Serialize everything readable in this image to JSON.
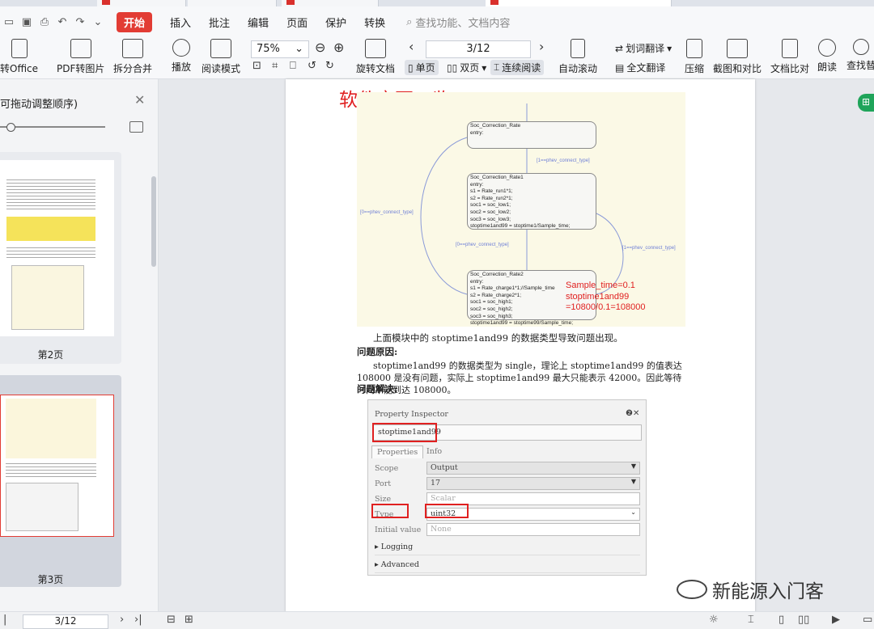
{
  "menubar": {
    "start": "开始",
    "items": [
      "插入",
      "批注",
      "编辑",
      "页面",
      "保护",
      "转换"
    ],
    "search": "查找功能、文档内容"
  },
  "toolbar": {
    "to_office": "转Office",
    "pdf_to_image": "PDF转图片",
    "split_merge": "拆分合并",
    "play": "播放",
    "read_mode": "阅读模式",
    "zoom": "75%",
    "rotate": "旋转文档",
    "page": "3/12",
    "single": "单页",
    "double": "双页",
    "continuous": "连续阅读",
    "auto_scroll": "自动滚动",
    "word_translate": "划词翻译",
    "full_translate": "全文翻译",
    "compress": "压缩",
    "screenshot_compare": "截图和对比",
    "doc_compare": "文档比对",
    "read_aloud": "朗读",
    "find_replace": "查找替"
  },
  "left_panel": {
    "title": "可拖动调整顺序)",
    "thumbs": [
      {
        "label": "第2页"
      },
      {
        "label": "第3页"
      }
    ]
  },
  "document": {
    "title": "软件变更一览",
    "diagram": {
      "states": [
        {
          "name": "Soc_Correction_Rate",
          "lines": [
            "entry:"
          ]
        },
        {
          "name": "Soc_Correction_Rate1",
          "lines": [
            "entry:",
            "s1 = Rate_run1*1;",
            "s2 = Rate_run2*1;",
            "soc1 = soc_low1;",
            "soc2 = soc_low2;",
            "soc3 = soc_low3;",
            "stoptime1and99 = stoptime1/Sample_time;"
          ]
        },
        {
          "name": "Soc_Correction_Rate2",
          "lines": [
            "entry:",
            "s1 = Rate_charge1*1;//Sample_time",
            "s2 = Rate_charge2*1;",
            "soc1 = soc_high1;",
            "soc2 = soc_high2;",
            "soc3 = soc_high3;",
            "stoptime1and99 = stoptime99/Sample_time;"
          ]
        }
      ],
      "transitions": [
        "[1==phev_connect_type]",
        "[0==phev_connect_type]",
        "[0==phev_connect_type]",
        "[1==phev_connect_type]"
      ],
      "annotation": [
        "Sample_time=0.1",
        "stoptime1and99",
        "=10800/0.1=108000"
      ]
    },
    "para1": "上面模块中的 stoptime1and99 的数据类型导致问题出现。",
    "cause_heading": "问题原因:",
    "cause_text": "stoptime1and99 的数据类型为 single，理论上 stoptime1and99 的值表达 108000 是没有问题，实际上 stoptime1and99 最大只能表示 42000。因此等待时间不能到达 108000。",
    "solution_heading": "问题解决:"
  },
  "inspector": {
    "header": "Property Inspector",
    "name": "stoptime1and99",
    "tabs": [
      "Properties",
      "Info"
    ],
    "rows": [
      {
        "label": "Scope",
        "value": "Output"
      },
      {
        "label": "Port",
        "value": "17"
      },
      {
        "label": "Size",
        "value": "Scalar"
      },
      {
        "label": "Type",
        "value": "uint32"
      },
      {
        "label": "Initial value",
        "value": "None"
      }
    ],
    "sections": [
      "Logging",
      "Advanced"
    ]
  },
  "watermark": "新能源入门客",
  "statusbar": {
    "page": "3/12"
  },
  "colors": {
    "accent_red": "#e23c34",
    "annotation_red": "#e02020",
    "transition_blue": "#6e7fd6",
    "diagram_bg": "#fbf9e6"
  }
}
